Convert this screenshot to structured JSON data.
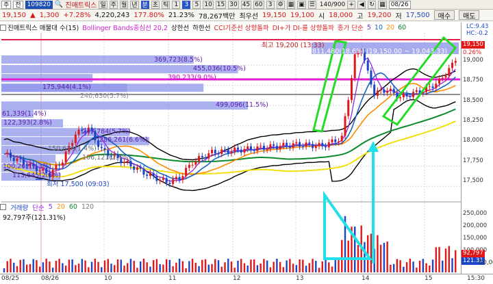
{
  "toolbar1": {
    "left_items": [
      "주",
      "전"
    ],
    "code": "109820",
    "stock_name": "진매트릭스",
    "periods": [
      "일",
      "주",
      "월",
      "년",
      "분",
      "초",
      "틱"
    ],
    "intervals": [
      "1",
      "3",
      "5",
      "10",
      "15",
      "30",
      "45",
      "60",
      "3"
    ],
    "count": "140/900",
    "date": "08/26"
  },
  "toolbar2": {
    "price": "19,150",
    "change": "1,300",
    "rate": "+7.28%",
    "volume": "4,220,243",
    "vol_rate": "177.80%",
    "turnover": "21.23%",
    "amount": "78,267백만",
    "priority_label": "최우선",
    "ask": "19,150",
    "bid": "19,100",
    "open_label": "시",
    "open": "18,000",
    "high_label": "고",
    "high": "19,200",
    "low_label": "저",
    "low": "17,500",
    "buy": "매수",
    "sell": "매도"
  },
  "legend": {
    "title": "진매트릭스 매물대 수(15)",
    "bollinger": "Bollinger Bands중심선 20,2",
    "up": "상한선",
    "down": "하한선",
    "cci": "CCI기준선 상향돌파",
    "di": "DI+가 DI-를 상향돌파",
    "ma": "종가 단순",
    "ma_periods": [
      "5",
      "10",
      "20",
      "60"
    ]
  },
  "price_axis": {
    "ticks": [
      "19,000",
      "18,750",
      "18,500",
      "18,250",
      "18,000",
      "17,750",
      "17,500"
    ],
    "lc": "LC:9.43",
    "hc": "HC:-0.2",
    "current": "19,150",
    "current_pct": "0.26%",
    "ylim": [
      17350,
      19400
    ]
  },
  "volume_profile": [
    {
      "label": "61,339(1.4%)",
      "price": 18400,
      "frac": 0.13
    },
    {
      "label": "122,393(2.8%)",
      "price": 18280,
      "frac": 0.25
    },
    {
      "label": "247,784(5.7%)",
      "price": 18170,
      "frac": 0.52
    },
    {
      "label": "286,261(6.6%)",
      "price": 18060,
      "frac": 0.6
    },
    {
      "label": "150,676(1.4%)",
      "price": 17950,
      "frac": 0.32
    },
    {
      "label": "106,121(2.4%)",
      "price": 17840,
      "frac": 0.22
    },
    {
      "label": "100,262(2.3%)",
      "price": 17730,
      "frac": 0.2
    },
    {
      "label": "113,645(2.6%)",
      "price": 17620,
      "frac": 0.24
    },
    {
      "label": "175,944(4.1%)",
      "price": 18840,
      "frac": 0.37
    },
    {
      "label": "240,630(5.7%)",
      "price": 18720,
      "frac": 0.51
    },
    {
      "label": "369,723(8.5%)",
      "price": 19070,
      "frac": 0.78
    },
    {
      "label": "455,036(10.5%)",
      "price": 18950,
      "frac": 0.96
    },
    {
      "label": "390,233(9.0%)",
      "price": 18720,
      "frac": 0.82
    },
    {
      "label": "499,096(11.5%)",
      "price": 18500,
      "frac": 1.0
    },
    {
      "label": "811,480(18.6%)",
      "price": 19180,
      "frac": 1.0
    }
  ],
  "annotations": {
    "high": "최고 19,200 (13:33)",
    "low": "최저 17,500 (09:03)",
    "range": "(19,150.00 ~ 19,043.33)"
  },
  "volume_panel": {
    "legend_title": "거래량",
    "ma_label": "단순",
    "ma_periods": [
      "5",
      "20",
      "60",
      "120"
    ],
    "value": "92,797주(121.31%)",
    "ticks": [
      "250,000",
      "200,000",
      "150,000",
      "100,000",
      "50,000"
    ],
    "tag_value": "92,797",
    "tag_pct": "121.31"
  },
  "xaxis": [
    "08/25",
    "08/26",
    "10",
    "11",
    "12",
    "13",
    "14",
    "15",
    "15:30"
  ],
  "colors": {
    "up": "#e01818",
    "down": "#1b45c8",
    "band": "#000000",
    "ma5": "#8a2be2",
    "ma10": "#1565c0",
    "ma20": "#ff8c00",
    "ma60": "#0a8a2a",
    "yellow": "#f0e010",
    "magenta": "#e020d0",
    "highlight": "#22dd22",
    "cyan": "#22e0e8"
  }
}
